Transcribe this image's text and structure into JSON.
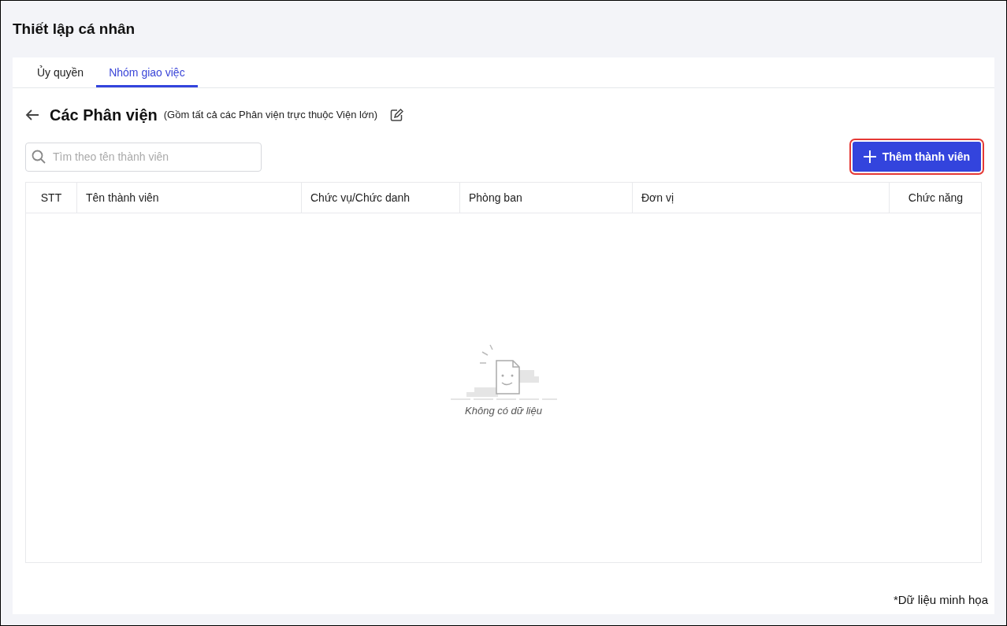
{
  "page_title": "Thiết lập cá nhân",
  "tabs": [
    {
      "label": "Ủy quyền",
      "selected": false
    },
    {
      "label": "Nhóm giao việc",
      "selected": true
    }
  ],
  "group": {
    "name": "Các Phân viện",
    "description": "(Gồm tất cả các Phân viện trực thuộc Viện lớn)"
  },
  "search": {
    "placeholder": "Tìm theo tên thành viên"
  },
  "add_button": {
    "label": "Thêm thành viên",
    "highlighted": true
  },
  "table": {
    "columns": [
      "STT",
      "Tên thành viên",
      "Chức vụ/Chức danh",
      "Phòng ban",
      "Đơn vị",
      "Chức năng"
    ],
    "empty_text": "Không có dữ liệu"
  },
  "footnote": "*Dữ liệu minh họa"
}
